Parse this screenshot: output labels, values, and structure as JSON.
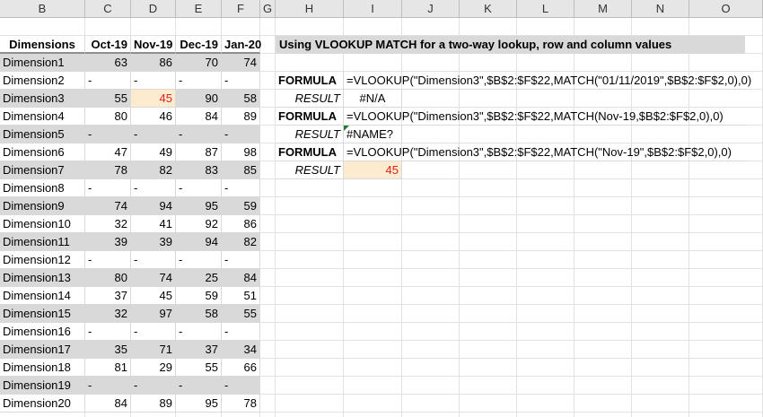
{
  "columns": [
    "B",
    "C",
    "D",
    "E",
    "F",
    "G",
    "H",
    "I",
    "J",
    "K",
    "L",
    "M",
    "N",
    "O"
  ],
  "table": {
    "headers": [
      "Dimensions",
      "Oct-19",
      "Nov-19",
      "Dec-19",
      "Jan-20"
    ],
    "rows": [
      [
        "Dimension1",
        "63",
        "86",
        "70",
        "74"
      ],
      [
        "Dimension2",
        "-",
        "-",
        "-",
        "-"
      ],
      [
        "Dimension3",
        "55",
        "45",
        "90",
        "58"
      ],
      [
        "Dimension4",
        "80",
        "46",
        "84",
        "89"
      ],
      [
        "Dimension5",
        "-",
        "-",
        "-",
        "-"
      ],
      [
        "Dimension6",
        "47",
        "49",
        "87",
        "98"
      ],
      [
        "Dimension7",
        "78",
        "82",
        "83",
        "85"
      ],
      [
        "Dimension8",
        "-",
        "-",
        "-",
        "-"
      ],
      [
        "Dimension9",
        "74",
        "94",
        "95",
        "59"
      ],
      [
        "Dimension10",
        "32",
        "41",
        "92",
        "86"
      ],
      [
        "Dimension11",
        "39",
        "39",
        "94",
        "82"
      ],
      [
        "Dimension12",
        "-",
        "-",
        "-",
        "-"
      ],
      [
        "Dimension13",
        "80",
        "74",
        "25",
        "84"
      ],
      [
        "Dimension14",
        "37",
        "45",
        "59",
        "51"
      ],
      [
        "Dimension15",
        "32",
        "97",
        "58",
        "55"
      ],
      [
        "Dimension16",
        "-",
        "-",
        "-",
        "-"
      ],
      [
        "Dimension17",
        "35",
        "71",
        "37",
        "34"
      ],
      [
        "Dimension18",
        "81",
        "29",
        "55",
        "66"
      ],
      [
        "Dimension19",
        "-",
        "-",
        "-",
        "-"
      ],
      [
        "Dimension20",
        "84",
        "89",
        "95",
        "78"
      ]
    ]
  },
  "panel": {
    "title": "Using VLOOKUP MATCH for a two-way lookup, row and column values",
    "formula_label": "FORMULA",
    "result_label": "RESULT",
    "formula1": "=VLOOKUP(\"Dimension3\",$B$2:$F$22,MATCH(\"01/11/2019\",$B$2:$F$2,0),0)",
    "result1": "#N/A",
    "formula2": "=VLOOKUP(\"Dimension3\",$B$2:$F$22,MATCH(Nov-19,$B$2:$F$2,0),0)",
    "result2": "#NAME?",
    "formula3": "=VLOOKUP(\"Dimension3\",$B$2:$F$22,MATCH(\"Nov-19\",$B$2:$F$2,0),0)",
    "result3": "45"
  },
  "colors": {
    "highlight": "#fdebd0",
    "red": "#e0201b",
    "band": "#d9d9d9"
  }
}
